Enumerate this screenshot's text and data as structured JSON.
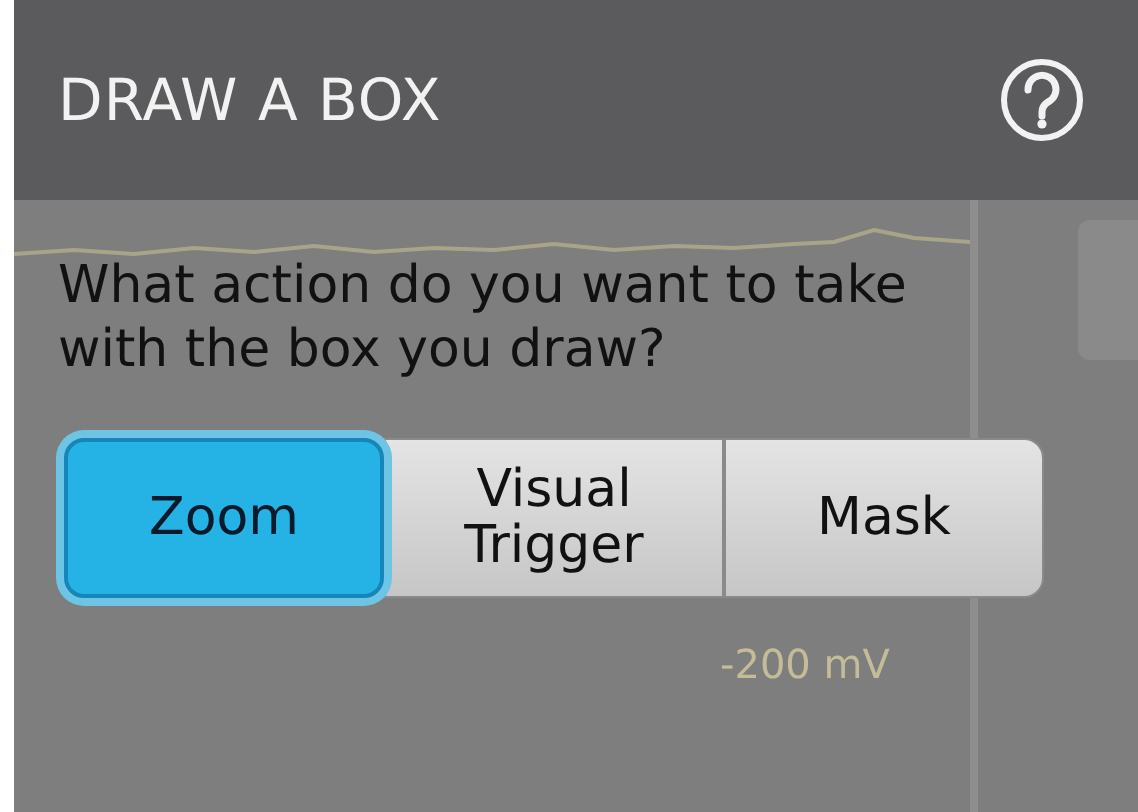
{
  "header": {
    "title": "DRAW A BOX"
  },
  "question": "What action do you want to take with the box you draw?",
  "actions": [
    {
      "label": "Zoom",
      "selected": true
    },
    {
      "label": "Visual Trigger",
      "selected": false
    },
    {
      "label": "Mask",
      "selected": false
    }
  ],
  "background_scale_label": "-200 mV"
}
